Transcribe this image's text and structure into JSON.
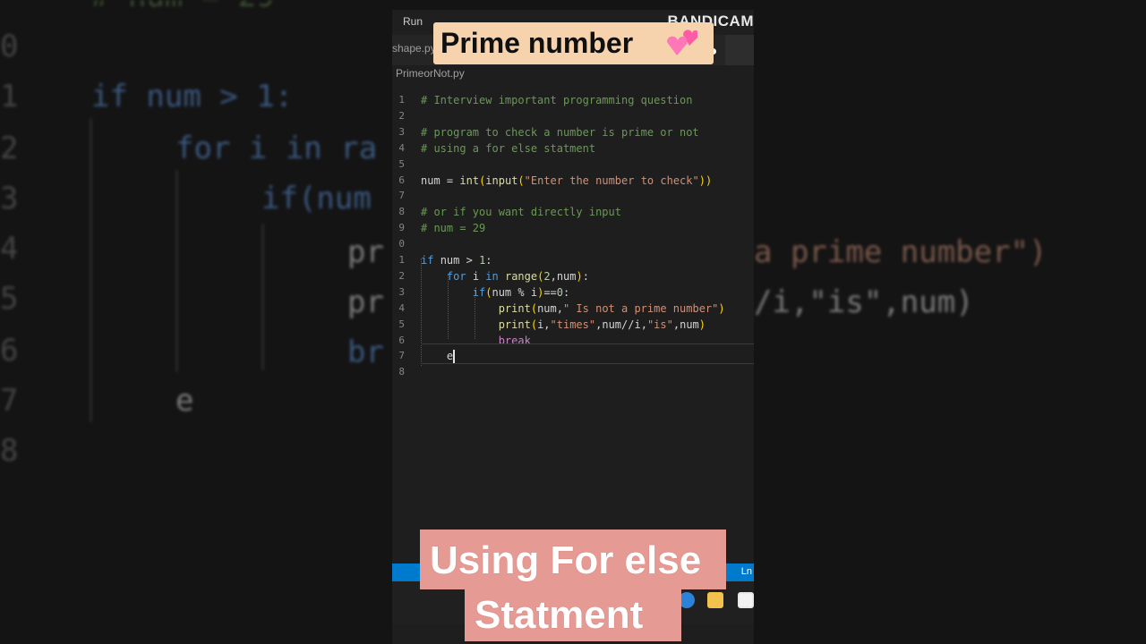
{
  "title_overlay": {
    "text": "Prime number",
    "icon": "two-hearts-icon"
  },
  "caption": {
    "line1": "Using For else",
    "line2": "Statment"
  },
  "menubar": {
    "run": "Run"
  },
  "watermark": "BANDICAM",
  "tabs": {
    "shape": "shape.py"
  },
  "breadcrumb": "PrimeorNot.py",
  "status": {
    "ln": "Ln"
  },
  "background_zoom": {
    "line_numbers": [
      "0",
      "1",
      "2",
      "3",
      "4",
      "5",
      "6",
      "7",
      "8"
    ],
    "left_lines": [
      "# num = 29",
      "if num > 1:",
      "for i in ra",
      "if(num",
      "",
      "",
      "",
      "e",
      ""
    ],
    "right_lines": [
      "a prime number\")",
      "/i,\"is\",num)"
    ]
  },
  "editor": {
    "lines": [
      {
        "num": "1",
        "text": "# Interview important programming question"
      },
      {
        "num": "2",
        "text": ""
      },
      {
        "num": "3",
        "text": "# program to check a number is prime or not"
      },
      {
        "num": "4",
        "text": "# using a for else statment"
      },
      {
        "num": "5",
        "text": ""
      },
      {
        "num": "6",
        "text": "num = int(input(\"Enter the number to check\"))"
      },
      {
        "num": "7",
        "text": ""
      },
      {
        "num": "8",
        "text": "# or if you want directly input"
      },
      {
        "num": "9",
        "text": "# num = 29"
      },
      {
        "num": "0",
        "text": ""
      },
      {
        "num": "1",
        "text": "if num > 1:"
      },
      {
        "num": "2",
        "text": "    for i in range(2,num):"
      },
      {
        "num": "3",
        "text": "        if(num % i)==0:"
      },
      {
        "num": "4",
        "text": "            print(num,\" Is not a prime number\")"
      },
      {
        "num": "5",
        "text": "            print(i,\"times\",num//i,\"is\",num)"
      },
      {
        "num": "6",
        "text": "            break"
      },
      {
        "num": "7",
        "text": "    e"
      },
      {
        "num": "8",
        "text": ""
      }
    ]
  }
}
